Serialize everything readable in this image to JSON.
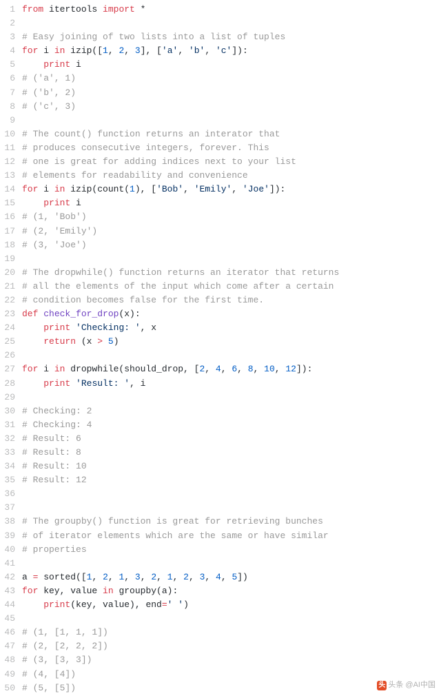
{
  "watermark": {
    "badge": "头",
    "text": "头条 @AI中国"
  },
  "lines": [
    {
      "n": 1,
      "t": [
        [
          "kw",
          "from"
        ],
        [
          "pl",
          " itertools "
        ],
        [
          "kw",
          "import"
        ],
        [
          "pl",
          " *"
        ]
      ]
    },
    {
      "n": 2,
      "t": [
        [
          "pl",
          ""
        ]
      ]
    },
    {
      "n": 3,
      "t": [
        [
          "cm",
          "# Easy joining of two lists into a list of tuples"
        ]
      ]
    },
    {
      "n": 4,
      "t": [
        [
          "kw",
          "for"
        ],
        [
          "pl",
          " i "
        ],
        [
          "kw",
          "in"
        ],
        [
          "pl",
          " izip(["
        ],
        [
          "nu",
          "1"
        ],
        [
          "pl",
          ", "
        ],
        [
          "nu",
          "2"
        ],
        [
          "pl",
          ", "
        ],
        [
          "nu",
          "3"
        ],
        [
          "pl",
          "], ["
        ],
        [
          "st",
          "'a'"
        ],
        [
          "pl",
          ", "
        ],
        [
          "st",
          "'b'"
        ],
        [
          "pl",
          ", "
        ],
        [
          "st",
          "'c'"
        ],
        [
          "pl",
          "]):"
        ]
      ]
    },
    {
      "n": 5,
      "t": [
        [
          "pl",
          "    "
        ],
        [
          "kw",
          "print"
        ],
        [
          "pl",
          " i"
        ]
      ]
    },
    {
      "n": 6,
      "t": [
        [
          "cm",
          "# ('a', 1)"
        ]
      ]
    },
    {
      "n": 7,
      "t": [
        [
          "cm",
          "# ('b', 2)"
        ]
      ]
    },
    {
      "n": 8,
      "t": [
        [
          "cm",
          "# ('c', 3)"
        ]
      ]
    },
    {
      "n": 9,
      "t": [
        [
          "pl",
          ""
        ]
      ]
    },
    {
      "n": 10,
      "t": [
        [
          "cm",
          "# The count() function returns an interator that"
        ]
      ]
    },
    {
      "n": 11,
      "t": [
        [
          "cm",
          "# produces consecutive integers, forever. This"
        ]
      ]
    },
    {
      "n": 12,
      "t": [
        [
          "cm",
          "# one is great for adding indices next to your list"
        ]
      ]
    },
    {
      "n": 13,
      "t": [
        [
          "cm",
          "# elements for readability and convenience"
        ]
      ]
    },
    {
      "n": 14,
      "t": [
        [
          "kw",
          "for"
        ],
        [
          "pl",
          " i "
        ],
        [
          "kw",
          "in"
        ],
        [
          "pl",
          " izip(count("
        ],
        [
          "nu",
          "1"
        ],
        [
          "pl",
          "), ["
        ],
        [
          "st",
          "'Bob'"
        ],
        [
          "pl",
          ", "
        ],
        [
          "st",
          "'Emily'"
        ],
        [
          "pl",
          ", "
        ],
        [
          "st",
          "'Joe'"
        ],
        [
          "pl",
          "]):"
        ]
      ]
    },
    {
      "n": 15,
      "t": [
        [
          "pl",
          "    "
        ],
        [
          "kw",
          "print"
        ],
        [
          "pl",
          " i"
        ]
      ]
    },
    {
      "n": 16,
      "t": [
        [
          "cm",
          "# (1, 'Bob')"
        ]
      ]
    },
    {
      "n": 17,
      "t": [
        [
          "cm",
          "# (2, 'Emily')"
        ]
      ]
    },
    {
      "n": 18,
      "t": [
        [
          "cm",
          "# (3, 'Joe')"
        ]
      ]
    },
    {
      "n": 19,
      "t": [
        [
          "pl",
          ""
        ]
      ]
    },
    {
      "n": 20,
      "t": [
        [
          "cm",
          "# The dropwhile() function returns an iterator that returns"
        ]
      ]
    },
    {
      "n": 21,
      "t": [
        [
          "cm",
          "# all the elements of the input which come after a certain"
        ]
      ]
    },
    {
      "n": 22,
      "t": [
        [
          "cm",
          "# condition becomes false for the first time."
        ]
      ]
    },
    {
      "n": 23,
      "t": [
        [
          "kw",
          "def"
        ],
        [
          "pl",
          " "
        ],
        [
          "fn",
          "check_for_drop"
        ],
        [
          "pl",
          "(x):"
        ]
      ]
    },
    {
      "n": 24,
      "t": [
        [
          "pl",
          "    "
        ],
        [
          "kw",
          "print"
        ],
        [
          "pl",
          " "
        ],
        [
          "st",
          "'Checking: '"
        ],
        [
          "pl",
          ", x"
        ]
      ]
    },
    {
      "n": 25,
      "t": [
        [
          "pl",
          "    "
        ],
        [
          "kw",
          "return"
        ],
        [
          "pl",
          " (x "
        ],
        [
          "op",
          ">"
        ],
        [
          "pl",
          " "
        ],
        [
          "nu",
          "5"
        ],
        [
          "pl",
          ")"
        ]
      ]
    },
    {
      "n": 26,
      "t": [
        [
          "pl",
          ""
        ]
      ]
    },
    {
      "n": 27,
      "t": [
        [
          "kw",
          "for"
        ],
        [
          "pl",
          " i "
        ],
        [
          "kw",
          "in"
        ],
        [
          "pl",
          " dropwhile(should_drop, ["
        ],
        [
          "nu",
          "2"
        ],
        [
          "pl",
          ", "
        ],
        [
          "nu",
          "4"
        ],
        [
          "pl",
          ", "
        ],
        [
          "nu",
          "6"
        ],
        [
          "pl",
          ", "
        ],
        [
          "nu",
          "8"
        ],
        [
          "pl",
          ", "
        ],
        [
          "nu",
          "10"
        ],
        [
          "pl",
          ", "
        ],
        [
          "nu",
          "12"
        ],
        [
          "pl",
          "]):"
        ]
      ]
    },
    {
      "n": 28,
      "t": [
        [
          "pl",
          "    "
        ],
        [
          "kw",
          "print"
        ],
        [
          "pl",
          " "
        ],
        [
          "st",
          "'Result: '"
        ],
        [
          "pl",
          ", i"
        ]
      ]
    },
    {
      "n": 29,
      "t": [
        [
          "pl",
          ""
        ]
      ]
    },
    {
      "n": 30,
      "t": [
        [
          "cm",
          "# Checking: 2"
        ]
      ]
    },
    {
      "n": 31,
      "t": [
        [
          "cm",
          "# Checking: 4"
        ]
      ]
    },
    {
      "n": 32,
      "t": [
        [
          "cm",
          "# Result: 6"
        ]
      ]
    },
    {
      "n": 33,
      "t": [
        [
          "cm",
          "# Result: 8"
        ]
      ]
    },
    {
      "n": 34,
      "t": [
        [
          "cm",
          "# Result: 10"
        ]
      ]
    },
    {
      "n": 35,
      "t": [
        [
          "cm",
          "# Result: 12"
        ]
      ]
    },
    {
      "n": 36,
      "t": [
        [
          "pl",
          ""
        ]
      ]
    },
    {
      "n": 37,
      "t": [
        [
          "pl",
          ""
        ]
      ]
    },
    {
      "n": 38,
      "t": [
        [
          "cm",
          "# The groupby() function is great for retrieving bunches"
        ]
      ]
    },
    {
      "n": 39,
      "t": [
        [
          "cm",
          "# of iterator elements which are the same or have similar"
        ]
      ]
    },
    {
      "n": 40,
      "t": [
        [
          "cm",
          "# properties"
        ]
      ]
    },
    {
      "n": 41,
      "t": [
        [
          "pl",
          ""
        ]
      ]
    },
    {
      "n": 42,
      "t": [
        [
          "pl",
          "a "
        ],
        [
          "op",
          "="
        ],
        [
          "pl",
          " sorted(["
        ],
        [
          "nu",
          "1"
        ],
        [
          "pl",
          ", "
        ],
        [
          "nu",
          "2"
        ],
        [
          "pl",
          ", "
        ],
        [
          "nu",
          "1"
        ],
        [
          "pl",
          ", "
        ],
        [
          "nu",
          "3"
        ],
        [
          "pl",
          ", "
        ],
        [
          "nu",
          "2"
        ],
        [
          "pl",
          ", "
        ],
        [
          "nu",
          "1"
        ],
        [
          "pl",
          ", "
        ],
        [
          "nu",
          "2"
        ],
        [
          "pl",
          ", "
        ],
        [
          "nu",
          "3"
        ],
        [
          "pl",
          ", "
        ],
        [
          "nu",
          "4"
        ],
        [
          "pl",
          ", "
        ],
        [
          "nu",
          "5"
        ],
        [
          "pl",
          "])"
        ]
      ]
    },
    {
      "n": 43,
      "t": [
        [
          "kw",
          "for"
        ],
        [
          "pl",
          " key, value "
        ],
        [
          "kw",
          "in"
        ],
        [
          "pl",
          " groupby(a):"
        ]
      ]
    },
    {
      "n": 44,
      "t": [
        [
          "pl",
          "    "
        ],
        [
          "kw",
          "print"
        ],
        [
          "pl",
          "(key, value), end"
        ],
        [
          "op",
          "="
        ],
        [
          "st",
          "' '"
        ],
        [
          "pl",
          ")"
        ]
      ]
    },
    {
      "n": 45,
      "t": [
        [
          "pl",
          ""
        ]
      ]
    },
    {
      "n": 46,
      "t": [
        [
          "cm",
          "# (1, [1, 1, 1])"
        ]
      ]
    },
    {
      "n": 47,
      "t": [
        [
          "cm",
          "# (2, [2, 2, 2])"
        ]
      ]
    },
    {
      "n": 48,
      "t": [
        [
          "cm",
          "# (3, [3, 3])"
        ]
      ]
    },
    {
      "n": 49,
      "t": [
        [
          "cm",
          "# (4, [4])"
        ]
      ]
    },
    {
      "n": 50,
      "t": [
        [
          "cm",
          "# (5, [5])"
        ]
      ]
    }
  ]
}
